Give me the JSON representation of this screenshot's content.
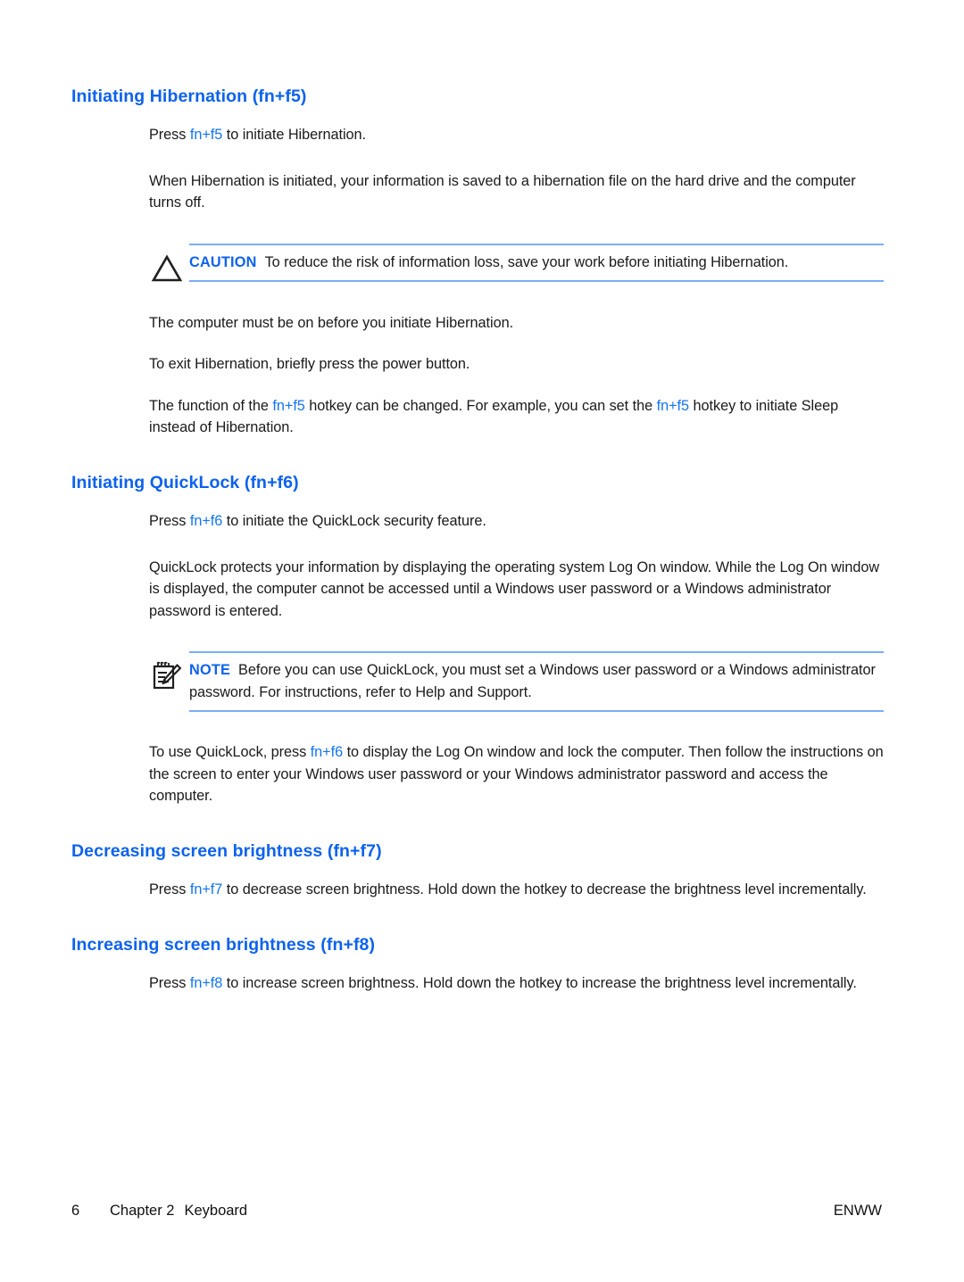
{
  "document": {
    "type": "user-guide-page",
    "colors": {
      "heading_blue": "#0C62EE",
      "inline_key_blue": "#1476F2",
      "rule_blue": "#79AEF6",
      "body_text": "#1a1a1a",
      "page_background": "#ffffff"
    }
  },
  "sections": [
    {
      "id": "hibernation",
      "heading": "Initiating Hibernation (fn+f5)",
      "paragraphs": [
        {
          "id": "hib-press",
          "parts": [
            {
              "text": "Press ",
              "style": "normal"
            },
            {
              "text": "fn+f5",
              "style": "key"
            },
            {
              "text": " to initiate Hibernation.",
              "style": "normal"
            }
          ]
        },
        {
          "id": "hib-when",
          "parts": [
            {
              "text": "When Hibernation is initiated, your information is saved to a hibernation file on the hard drive and the computer turns off.",
              "style": "normal"
            }
          ]
        }
      ],
      "admonition": {
        "id": "caution-info-loss",
        "kind": "caution",
        "icon": "warning-triangle-icon",
        "label": "CAUTION",
        "text": "To reduce the risk of information loss, save your work before initiating Hibernation."
      },
      "paragraphs_after": [
        {
          "id": "hib-must-be-on",
          "parts": [
            {
              "text": "The computer must be on before you initiate Hibernation.",
              "style": "normal"
            }
          ]
        },
        {
          "id": "hib-exit",
          "parts": [
            {
              "text": "To exit Hibernation, briefly press the power button.",
              "style": "normal"
            }
          ]
        },
        {
          "id": "hib-function",
          "parts": [
            {
              "text": "The function of the ",
              "style": "normal"
            },
            {
              "text": "fn+f5",
              "style": "key"
            },
            {
              "text": " hotkey can be changed. For example, you can set the ",
              "style": "normal"
            },
            {
              "text": "fn+f5",
              "style": "key"
            },
            {
              "text": " hotkey to initiate Sleep instead of Hibernation.",
              "style": "normal"
            }
          ]
        }
      ]
    },
    {
      "id": "quicklock",
      "heading": "Initiating QuickLock (fn+f6)",
      "paragraphs": [
        {
          "id": "ql-press",
          "parts": [
            {
              "text": "Press ",
              "style": "normal"
            },
            {
              "text": "fn+f6",
              "style": "key"
            },
            {
              "text": " to initiate the QuickLock security feature.",
              "style": "normal"
            }
          ]
        },
        {
          "id": "ql-protects",
          "parts": [
            {
              "text": "QuickLock protects your information by displaying the operating system Log On window. While the Log On window is displayed, the computer cannot be accessed until a Windows user password or a Windows administrator password is entered.",
              "style": "normal"
            }
          ]
        }
      ],
      "admonition": {
        "id": "note-quicklock-password",
        "kind": "note",
        "icon": "notepad-pencil-icon",
        "label": "NOTE",
        "text": "Before you can use QuickLock, you must set a Windows user password or a Windows administrator password. For instructions, refer to Help and Support."
      },
      "paragraphs_after": [
        {
          "id": "ql-to-use",
          "parts": [
            {
              "text": "To use QuickLock, press ",
              "style": "normal"
            },
            {
              "text": "fn+f6",
              "style": "key"
            },
            {
              "text": " to display the Log On window and lock the computer. Then follow the instructions on the screen to enter your Windows user password or your Windows administrator password and access the computer.",
              "style": "normal"
            }
          ]
        }
      ]
    },
    {
      "id": "decrease-brightness",
      "heading": "Decreasing screen brightness (fn+f7)",
      "paragraphs": [
        {
          "id": "dec-press",
          "parts": [
            {
              "text": "Press ",
              "style": "normal"
            },
            {
              "text": "fn+f7",
              "style": "key"
            },
            {
              "text": " to decrease screen brightness. Hold down the hotkey to decrease the brightness level incrementally.",
              "style": "normal"
            }
          ]
        }
      ]
    },
    {
      "id": "increase-brightness",
      "heading": "Increasing screen brightness (fn+f8)",
      "paragraphs": [
        {
          "id": "inc-press",
          "parts": [
            {
              "text": "Press ",
              "style": "normal"
            },
            {
              "text": "fn+f8",
              "style": "key"
            },
            {
              "text": " to increase screen brightness. Hold down the hotkey to increase the brightness level incrementally.",
              "style": "normal"
            }
          ]
        }
      ]
    }
  ],
  "footer": {
    "page_number": "6",
    "chapter": "Chapter 2",
    "chapter_title": "Keyboard",
    "locale_code": "ENWW"
  }
}
